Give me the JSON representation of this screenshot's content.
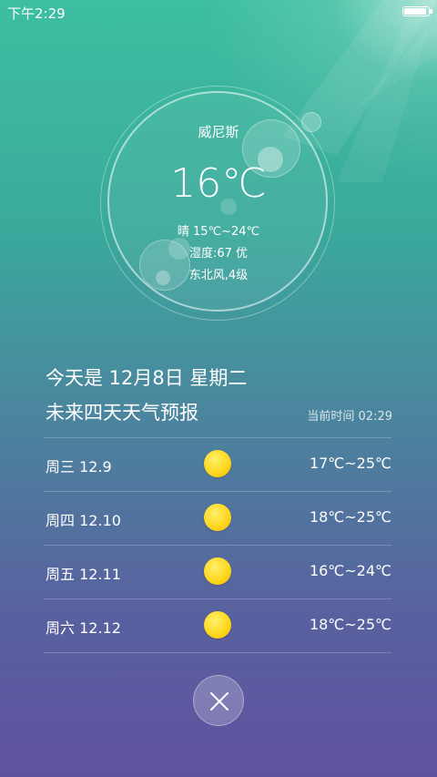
{
  "status_bar": {
    "time": "下午2:29"
  },
  "current": {
    "city": "威尼斯",
    "temperature": "16℃",
    "condition": "晴  15℃~24℃",
    "humidity": "湿度:67 优",
    "wind": "东北风,4级"
  },
  "today": "今天是  12月8日  星期二",
  "forecast": {
    "title": "未来四天天气预报",
    "current_time": "当前时间 02:29",
    "days": [
      {
        "day": "周三  12.9",
        "icon": "sun-icon",
        "range": "17℃~25℃"
      },
      {
        "day": "周四  12.10",
        "icon": "sun-icon",
        "range": "18℃~25℃"
      },
      {
        "day": "周五  12.11",
        "icon": "sun-icon",
        "range": "16℃~24℃"
      },
      {
        "day": "周六  12.12",
        "icon": "sun-icon",
        "range": "18℃~25℃"
      }
    ]
  },
  "close_icon": "close-icon",
  "colors": {
    "gradient_top": "#3dbfa0",
    "gradient_bottom": "#6152a0",
    "sun": "#ffd81f"
  }
}
